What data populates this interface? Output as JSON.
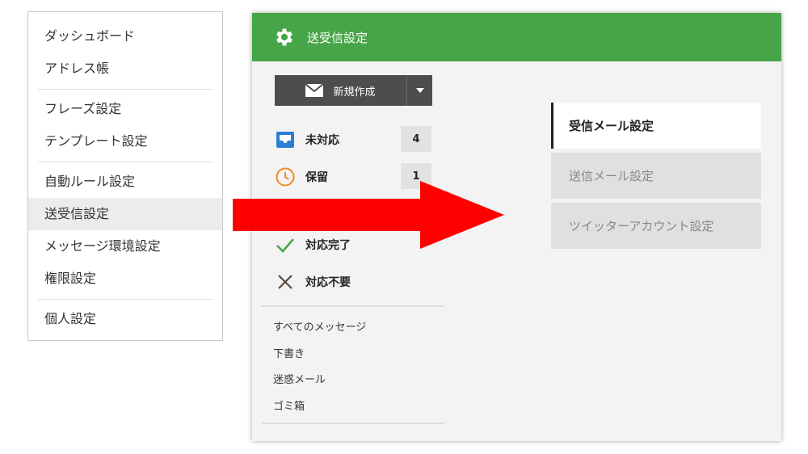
{
  "menu": {
    "items": [
      {
        "label": "ダッシュボード"
      },
      {
        "label": "アドレス帳"
      },
      {
        "label": "フレーズ設定"
      },
      {
        "label": "テンプレート設定"
      },
      {
        "label": "自動ルール設定"
      },
      {
        "label": "送受信設定"
      },
      {
        "label": "メッセージ環境設定"
      },
      {
        "label": "権限設定"
      },
      {
        "label": "個人設定"
      }
    ]
  },
  "header": {
    "title": "送受信設定",
    "icon": "gear-icon",
    "color": "#46a546"
  },
  "compose": {
    "label": "新規作成",
    "icon": "envelope-icon"
  },
  "statuses": [
    {
      "label": "未対応",
      "count": "4",
      "icon": "inbox-icon",
      "color": "#2a7fd4"
    },
    {
      "label": "保留",
      "count": "1",
      "icon": "clock-icon",
      "color": "#f08c1e"
    },
    {
      "label": "対応完了",
      "icon": "check-icon",
      "color": "#46a546"
    },
    {
      "label": "対応不要",
      "icon": "x-icon",
      "color": "#5a4a3a"
    }
  ],
  "folders": [
    {
      "label": "すべてのメッセージ"
    },
    {
      "label": "下書き"
    },
    {
      "label": "迷惑メール"
    },
    {
      "label": "ゴミ箱"
    }
  ],
  "tabs": [
    {
      "label": "受信メール設定",
      "active": true
    },
    {
      "label": "送信メール設定",
      "active": false
    },
    {
      "label": "ツイッターアカウント設定",
      "active": false
    }
  ],
  "annotation": {
    "arrow_color": "#ff0000"
  }
}
